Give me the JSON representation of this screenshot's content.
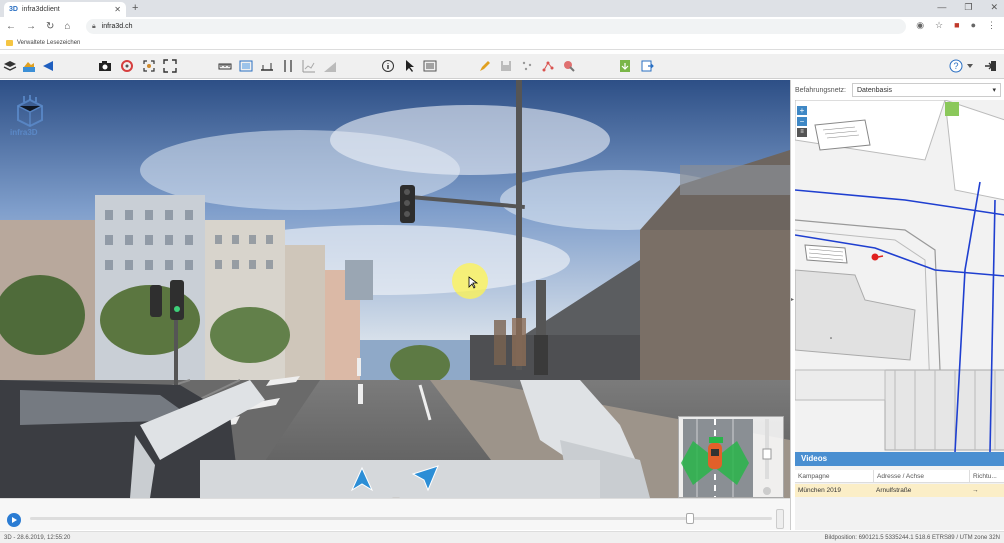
{
  "browser": {
    "tab_title": "infra3dclient",
    "tab_favicon": "3D",
    "new_tab": "+",
    "url": "infra3d.ch",
    "bookmark_folder": "Verwaltete Lesezeichen",
    "window_controls": [
      "—",
      "❐",
      "✕"
    ],
    "nav_icons": [
      "back-icon",
      "forward-icon",
      "reload-icon",
      "home-icon"
    ]
  },
  "toolbar": {
    "groups": [
      [
        "layers-icon",
        "terrain-icon",
        "navigate-icon"
      ],
      [
        "camera-icon",
        "color-icon",
        "scan-icon",
        "fullscreen-icon"
      ],
      [
        "measure-height-icon",
        "measure-area-icon",
        "measure-distance-icon",
        "profile-icon",
        "chart-icon",
        "slope-icon"
      ],
      [
        "info-icon",
        "pointer-icon",
        "list-icon"
      ],
      [
        "pen-icon",
        "save-icon",
        "points-icon",
        "graph-icon",
        "tool-icon"
      ],
      [
        "export-icon",
        "import-icon"
      ]
    ],
    "right_icons": [
      "help-icon",
      "logout-icon"
    ]
  },
  "viewer": {
    "logo_text": "infra3D",
    "bg_sky": "#6a8cc0",
    "accent": "#4a8fd1"
  },
  "sidebar": {
    "network_label": "Befahrungsnetz:",
    "network_value": "Datenbasis",
    "zoom_in": "+",
    "zoom_out": "−",
    "videos_title": "Videos",
    "columns": [
      "Kampagne",
      "Adresse / Achse",
      "Richtu..."
    ],
    "rows": [
      {
        "campaign": "München 2019",
        "address": "Arnulfstraße",
        "direction": "→"
      }
    ]
  },
  "player": {
    "position_fraction": 0.89
  },
  "status": {
    "left": "3D - 28.6.2019, 12:55:20",
    "right": "Bildposition: 690121.5 5335244.1 518.6 ETRS89 / UTM zone 32N"
  }
}
